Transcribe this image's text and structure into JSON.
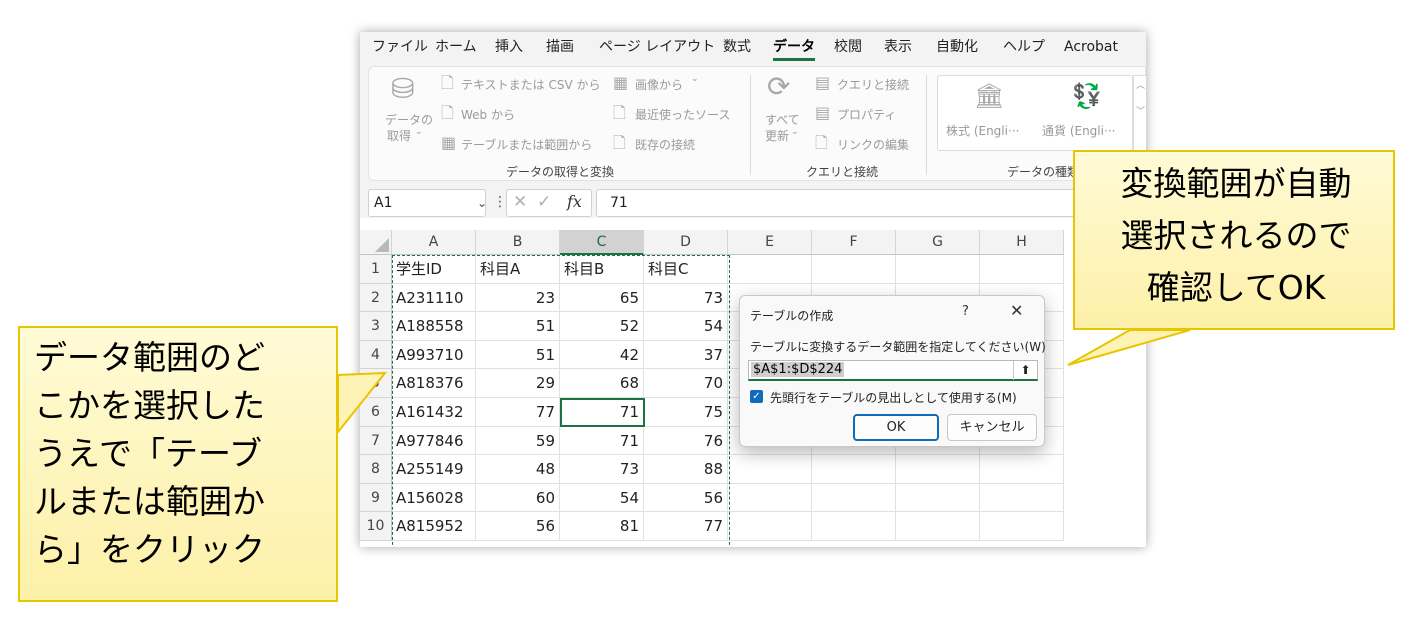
{
  "menu": {
    "tabs": [
      {
        "label": "ファイル",
        "active": false
      },
      {
        "label": "ホーム",
        "active": false
      },
      {
        "label": "挿入",
        "active": false
      },
      {
        "label": "描画",
        "active": false
      },
      {
        "label": "ページ レイアウト",
        "active": false
      },
      {
        "label": "数式",
        "active": false
      },
      {
        "label": "データ",
        "active": true
      },
      {
        "label": "校閲",
        "active": false
      },
      {
        "label": "表示",
        "active": false
      },
      {
        "label": "自動化",
        "active": false
      },
      {
        "label": "ヘルプ",
        "active": false
      },
      {
        "label": "Acrobat",
        "active": false
      }
    ]
  },
  "ribbon": {
    "get_data_label_1": "データの",
    "get_data_label_2": "取得",
    "from_text_csv": "テキストまたは CSV から",
    "from_web": "Web から",
    "from_table_range": "テーブルまたは範囲から",
    "from_picture": "画像から",
    "recent_sources": "最近使ったソース",
    "existing_connections": "既存の接続",
    "group_get_transform": "データの取得と変換",
    "refresh_all_1": "すべて",
    "refresh_all_2": "更新",
    "queries_connections": "クエリと接続",
    "properties": "プロパティ",
    "edit_links": "リンクの編集",
    "group_queries": "クエリと接続",
    "stocks": "株式 (Engli···",
    "currencies": "通貨 (Engli···",
    "group_data_types": "データの種類"
  },
  "formula_bar": {
    "name_box": "A1",
    "value": "71"
  },
  "sheet": {
    "columns": [
      "A",
      "B",
      "C",
      "D",
      "E",
      "F",
      "G",
      "H"
    ],
    "selected_column": "C",
    "rows": [
      {
        "num": "1",
        "cells": [
          "学生ID",
          "科目A",
          "科目B",
          "科目C"
        ]
      },
      {
        "num": "2",
        "cells": [
          "A231110",
          "23",
          "65",
          "73"
        ]
      },
      {
        "num": "3",
        "cells": [
          "A188558",
          "51",
          "52",
          "54"
        ]
      },
      {
        "num": "4",
        "cells": [
          "A993710",
          "51",
          "42",
          "37"
        ]
      },
      {
        "num": "5",
        "cells": [
          "A818376",
          "29",
          "68",
          "70"
        ]
      },
      {
        "num": "6",
        "cells": [
          "A161432",
          "77",
          "71",
          "75"
        ]
      },
      {
        "num": "7",
        "cells": [
          "A977846",
          "59",
          "71",
          "76"
        ]
      },
      {
        "num": "8",
        "cells": [
          "A255149",
          "48",
          "73",
          "88"
        ]
      },
      {
        "num": "9",
        "cells": [
          "A156028",
          "60",
          "54",
          "56"
        ]
      },
      {
        "num": "10",
        "cells": [
          "A815952",
          "56",
          "81",
          "77"
        ]
      }
    ]
  },
  "dialog": {
    "title": "テーブルの作成",
    "help": "?",
    "close": "✕",
    "range_label": "テーブルに変換するデータ範囲を指定してください(W)",
    "range_value": "$A$1:$D$224",
    "has_headers_label": "先頭行をテーブルの見出しとして使用する(M)",
    "has_headers_checked": true,
    "ok": "OK",
    "cancel": "キャンセル"
  },
  "callouts": {
    "left": "データ範囲のど\nこかを選択した\nうえで「テーブ\nルまたは範囲か\nら」をクリック",
    "right": "変換範囲が自動\n選択されるので\n確認してOK"
  },
  "colors": {
    "accent_green": "#1e7145",
    "dialog_blue": "#0f6cbd",
    "callout_fill": "#fdf3b4",
    "callout_border": "#e9c400"
  }
}
